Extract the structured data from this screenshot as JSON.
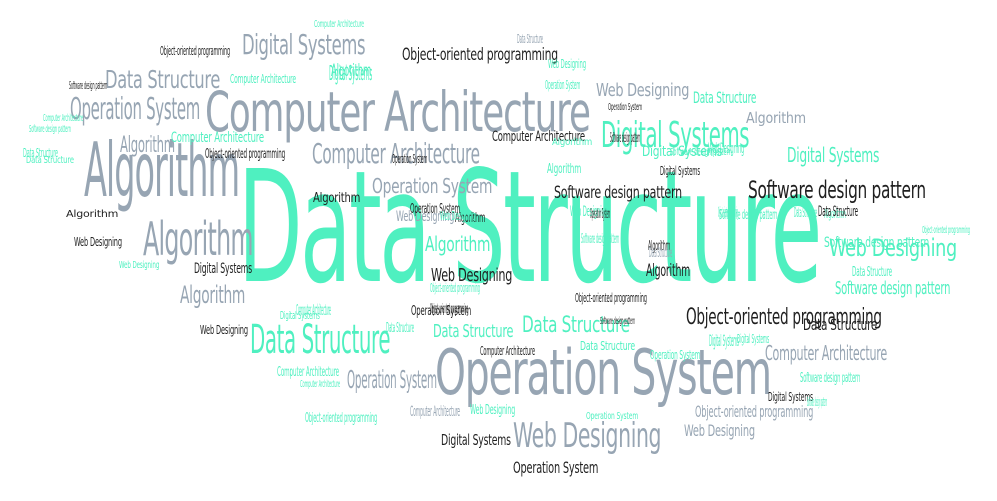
{
  "palette": {
    "teal": "#4ff0c0",
    "gray": "#97a5b3",
    "dark": "#1f1f1f"
  },
  "words": [
    {
      "text": "Data Structure",
      "color": "teal"
    },
    {
      "text": "Computer Architecture",
      "color": "gray"
    },
    {
      "text": "Operation System",
      "color": "gray"
    },
    {
      "text": "Algorithm",
      "color": "gray"
    },
    {
      "text": "Algorithm",
      "color": "gray"
    },
    {
      "text": "Digital Systems",
      "color": "gray"
    },
    {
      "text": "Data Structure",
      "color": "teal"
    },
    {
      "text": "Operation System",
      "color": "gray"
    },
    {
      "text": "Computer Architecture",
      "color": "gray"
    },
    {
      "text": "Web Designing",
      "color": "gray"
    },
    {
      "text": "Digital Systems",
      "color": "teal"
    },
    {
      "text": "Data Structure",
      "color": "gray"
    },
    {
      "text": "Software design pattern",
      "color": "dark"
    },
    {
      "text": "Algorithm",
      "color": "gray"
    },
    {
      "text": "Algorithm",
      "color": "gray"
    },
    {
      "text": "Web Designing",
      "color": "teal"
    },
    {
      "text": "Object-oriented programming",
      "color": "dark"
    },
    {
      "text": "Data Structure",
      "color": "teal"
    },
    {
      "text": "Data Structure",
      "color": "teal"
    },
    {
      "text": "Operation System",
      "color": "gray"
    },
    {
      "text": "Web Designing",
      "color": "gray"
    },
    {
      "text": "Algorithm",
      "color": "teal"
    },
    {
      "text": "Computer Architecture",
      "color": "gray"
    },
    {
      "text": "Digital Systems",
      "color": "teal"
    },
    {
      "text": "Digital Systems",
      "color": "teal"
    },
    {
      "text": "Software design pattern",
      "color": "teal"
    },
    {
      "text": "Object-oriented programming",
      "color": "dark"
    },
    {
      "text": "Web Designing",
      "color": "gray"
    },
    {
      "text": "Software design pattern",
      "color": "dark"
    },
    {
      "text": "Web Designing",
      "color": "dark"
    },
    {
      "text": "Operation System",
      "color": "gray"
    },
    {
      "text": "Algorithm",
      "color": "gray"
    },
    {
      "text": "Data Structure",
      "color": "teal"
    },
    {
      "text": "Algorithm",
      "color": "teal"
    },
    {
      "text": "Data Structure",
      "color": "teal"
    },
    {
      "text": "Object-oriented programming",
      "color": "gray"
    },
    {
      "text": "Computer Architecture",
      "color": "teal"
    },
    {
      "text": "Algorithm",
      "color": "teal"
    },
    {
      "text": "Computer Architecture",
      "color": "dark"
    },
    {
      "text": "Data Structure",
      "color": "teal"
    },
    {
      "text": "Algorithm",
      "color": "dark"
    },
    {
      "text": "Algorithm",
      "color": "dark"
    },
    {
      "text": "Software design pattern",
      "color": "dark"
    },
    {
      "text": "Software design pattern",
      "color": "teal"
    },
    {
      "text": "Data Structure",
      "color": "teal"
    },
    {
      "text": "Software design pattern",
      "color": "teal"
    },
    {
      "text": "Digital Systems",
      "color": "dark"
    },
    {
      "text": "Digital Systems",
      "color": "dark"
    },
    {
      "text": "Operation System",
      "color": "dark"
    },
    {
      "text": "Operation System",
      "color": "dark"
    },
    {
      "text": "Software design pattern",
      "color": "teal"
    },
    {
      "text": "Computer Architecture",
      "color": "teal"
    },
    {
      "text": "Web Designing",
      "color": "teal"
    },
    {
      "text": "Data Structure",
      "color": "gray"
    },
    {
      "text": "Web Designing",
      "color": "gray"
    },
    {
      "text": "Digital Systems",
      "color": "teal"
    },
    {
      "text": "Object-oriented programming",
      "color": "dark"
    },
    {
      "text": "Data Structure",
      "color": "dark"
    },
    {
      "text": "Algorithm",
      "color": "dark"
    },
    {
      "text": "Algorithm",
      "color": "dark"
    },
    {
      "text": "Web Designing",
      "color": "teal"
    },
    {
      "text": "Digital Systems",
      "color": "teal"
    },
    {
      "text": "Computer Architecture",
      "color": "dark"
    },
    {
      "text": "Web Designing",
      "color": "dark"
    },
    {
      "text": "Web Designing",
      "color": "teal"
    },
    {
      "text": "Data Structure",
      "color": "teal"
    },
    {
      "text": "Data Structure",
      "color": "teal"
    },
    {
      "text": "Operation System",
      "color": "dark"
    },
    {
      "text": "Object-oriented programming",
      "color": "dark"
    },
    {
      "text": "Data Structure",
      "color": "dark"
    },
    {
      "text": "Computer Architecture",
      "color": "teal"
    },
    {
      "text": "Web Designing",
      "color": "dark"
    },
    {
      "text": "Data Structure",
      "color": "teal"
    },
    {
      "text": "Digital Systems",
      "color": "dark"
    },
    {
      "text": "Object-oriented programming",
      "color": "dark"
    },
    {
      "text": "Computer Architecture",
      "color": "teal"
    },
    {
      "text": "Web Designing",
      "color": "teal"
    },
    {
      "text": "Object-oriented programming",
      "color": "teal"
    },
    {
      "text": "Computer Architecture",
      "color": "teal"
    },
    {
      "text": "Web Designing",
      "color": "teal"
    },
    {
      "text": "Software design pattern",
      "color": "teal"
    },
    {
      "text": "Object-oriented programming",
      "color": "teal"
    },
    {
      "text": "Operation System",
      "color": "teal"
    },
    {
      "text": "Computer Architecture",
      "color": "teal"
    },
    {
      "text": "Software design pattern",
      "color": "teal"
    },
    {
      "text": "Digital Systems",
      "color": "dark"
    },
    {
      "text": "Algorithm",
      "color": "dark"
    },
    {
      "text": "Software design pattern",
      "color": "dark"
    },
    {
      "text": "Algorithm",
      "color": "teal"
    },
    {
      "text": "Operation System",
      "color": "dark"
    },
    {
      "text": "Algorithm",
      "color": "teal"
    },
    {
      "text": "Data Structure",
      "color": "gray"
    },
    {
      "text": "Object-oriented programming",
      "color": "teal"
    },
    {
      "text": "Computer Architecture",
      "color": "teal"
    },
    {
      "text": "Computer Architecture",
      "color": "gray"
    },
    {
      "text": "Digital Systems",
      "color": "teal"
    },
    {
      "text": "Operation System",
      "color": "dark"
    },
    {
      "text": "Object-oriented programming",
      "color": "dark"
    },
    {
      "text": "Digital Systems",
      "color": "teal"
    },
    {
      "text": "Web Designing",
      "color": "teal"
    },
    {
      "text": "Operation System",
      "color": "teal"
    },
    {
      "text": "Software design pattern",
      "color": "teal"
    },
    {
      "text": "Operation System",
      "color": "teal"
    },
    {
      "text": "Operation System",
      "color": "dark"
    },
    {
      "text": "Software design pattern",
      "color": "teal"
    },
    {
      "text": "Object-oriented programming",
      "color": "teal"
    },
    {
      "text": "Software design pattern",
      "color": "dark"
    }
  ]
}
